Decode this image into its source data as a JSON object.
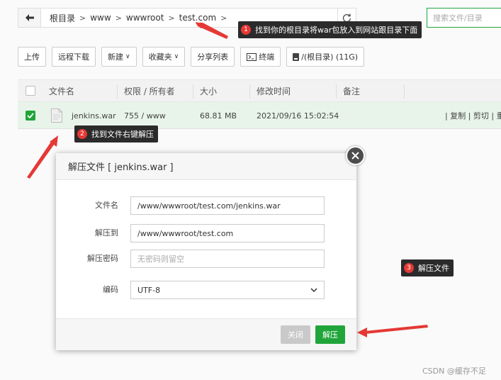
{
  "breadcrumb": {
    "items": [
      "根目录",
      "www",
      "wwwroot",
      "test.com"
    ]
  },
  "search": {
    "placeholder": "搜索文件/目录"
  },
  "toolbar": {
    "upload": "上传",
    "remote_download": "远程下载",
    "new": "新建",
    "favorites": "收藏夹",
    "share_list": "分享列表",
    "terminal": "终端",
    "disk": "/(根目录) (11G)"
  },
  "table": {
    "headers": [
      "文件名",
      "权限 / 所有者",
      "大小",
      "修改时间",
      "备注"
    ],
    "rows": [
      {
        "name": "jenkins.war",
        "permission": "755 / www",
        "size": "68.81 MB",
        "modified": "2021/09/16 15:02:54",
        "ops": "| 复制 | 剪切 | 重"
      }
    ]
  },
  "annotations": {
    "a1": {
      "num": "1",
      "text": "找到你的根目录将war包放入到网站跟目录下面"
    },
    "a2": {
      "num": "2",
      "text": "找到文件右键解压"
    },
    "a3": {
      "num": "3",
      "text": "解压文件"
    }
  },
  "modal": {
    "title": "解压文件 [ jenkins.war ]",
    "fields": {
      "filename": {
        "label": "文件名",
        "value": "/www/wwwroot/test.com/jenkins.war"
      },
      "extract_to": {
        "label": "解压到",
        "value": "/www/wwwroot/test.com"
      },
      "password": {
        "label": "解压密码",
        "placeholder": "无密码则留空"
      },
      "encoding": {
        "label": "编码",
        "value": "UTF-8"
      }
    },
    "close_label": "关闭",
    "extract_label": "解压"
  },
  "watermark": "CSDN @缓存不足",
  "colors": {
    "accent": "#20a53a",
    "annotation_red": "#e53935",
    "tip_bg": "#2b2b2b"
  }
}
